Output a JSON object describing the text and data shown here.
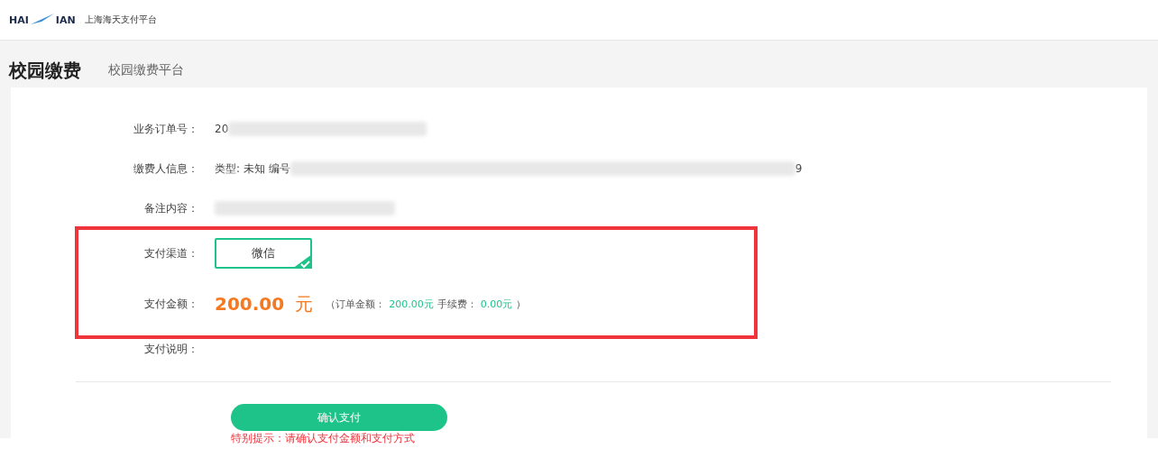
{
  "header": {
    "logo_left": "HAI",
    "logo_right": "IAN",
    "platform_name": "上海海天支付平台"
  },
  "page": {
    "title": "校园缴费",
    "subtitle": "校园缴费平台"
  },
  "fields": [
    {
      "kind": "blurred",
      "label": "业务订单号：",
      "prefix": "20"
    },
    {
      "kind": "blurred",
      "label": "缴费人信息：",
      "prefix": "类型: 未知  编号",
      "suffix": "9"
    },
    {
      "kind": "blurred",
      "label": "备注内容："
    }
  ],
  "payment_channel": {
    "label": "支付渠道：",
    "options": [
      {
        "label": "微信",
        "selected": true
      }
    ]
  },
  "payment_amount": {
    "label": "支付金额：",
    "amount": "200.00",
    "unit": "元",
    "open": "（订单金额：",
    "order_amount": "200.00元",
    "fee_label": "手续费：",
    "fee": "0.00元",
    "close": "）"
  },
  "payment_note": {
    "label": "支付说明："
  },
  "confirm_button": "确认支付",
  "warning": "特别提示：请确认支付金额和支付方式"
}
